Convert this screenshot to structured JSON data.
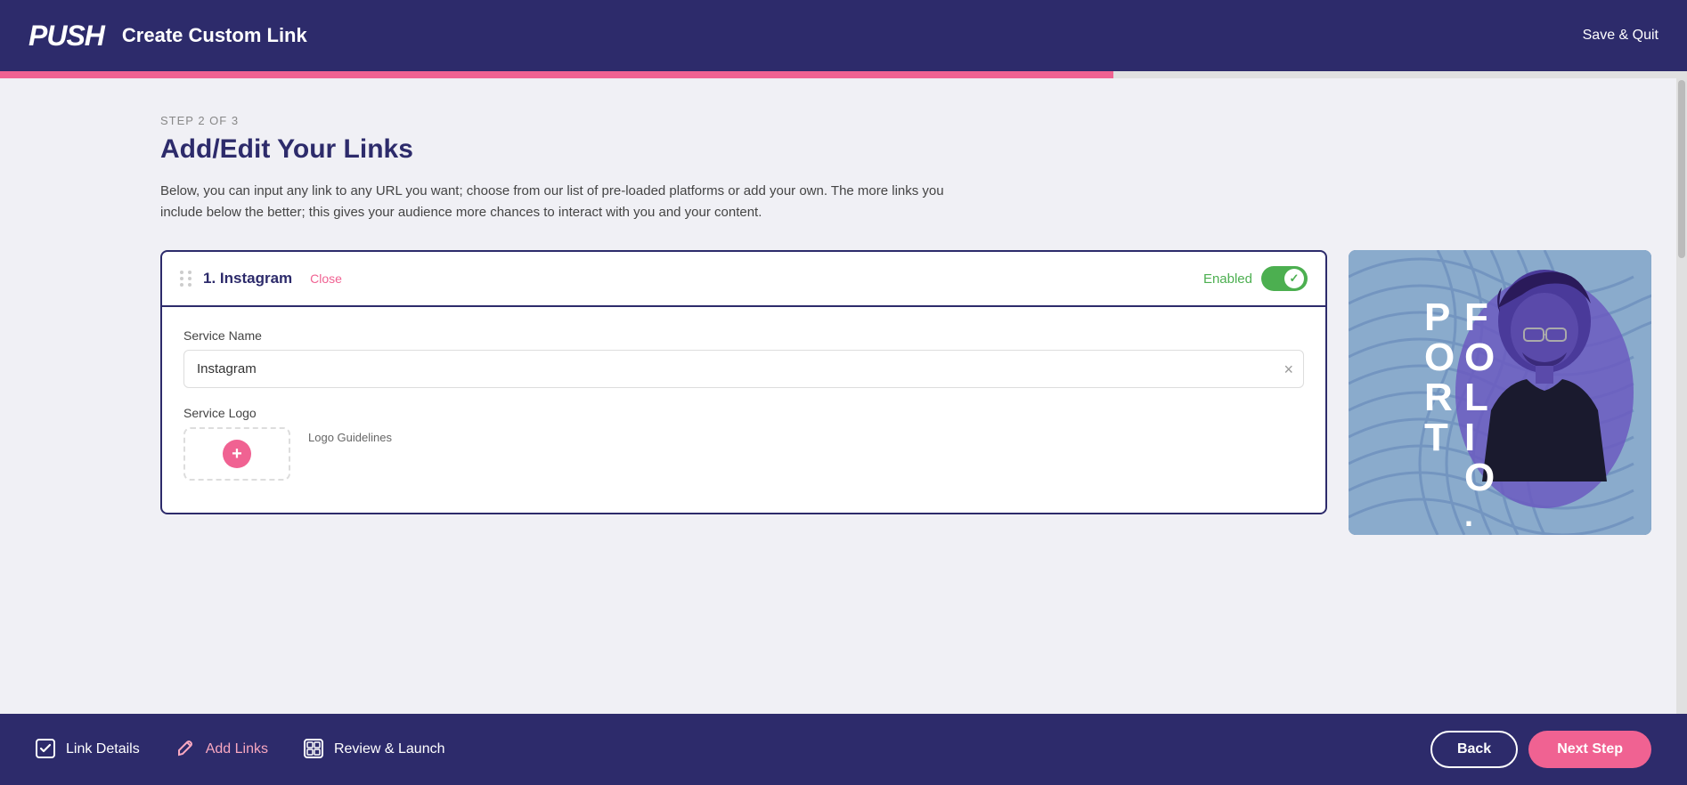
{
  "header": {
    "logo": "PUSH",
    "title": "Create Custom Link",
    "save_quit": "Save & Quit"
  },
  "progress": {
    "fill_percent": "66%",
    "step_label": "STEP 2 OF 3"
  },
  "page": {
    "title": "Add/Edit Your Links",
    "description": "Below, you can input any link to any URL you want; choose from our list of pre-loaded platforms or add your own. The more links you include below the better; this gives your audience more chances to interact with you and your content."
  },
  "link_item": {
    "number": "1.",
    "name": "Instagram",
    "close_label": "Close",
    "enabled_label": "Enabled",
    "service_name_label": "Service Name",
    "service_name_value": "Instagram",
    "service_logo_label": "Service Logo",
    "logo_guidelines": "Logo Guidelines"
  },
  "footer": {
    "steps": [
      {
        "label": "Link Details",
        "icon": "✓",
        "active": false
      },
      {
        "label": "Add Links",
        "icon": "✎",
        "active": true
      },
      {
        "label": "Review & Launch",
        "icon": "⊡",
        "active": false
      }
    ],
    "back_label": "Back",
    "next_label": "Next Step"
  }
}
